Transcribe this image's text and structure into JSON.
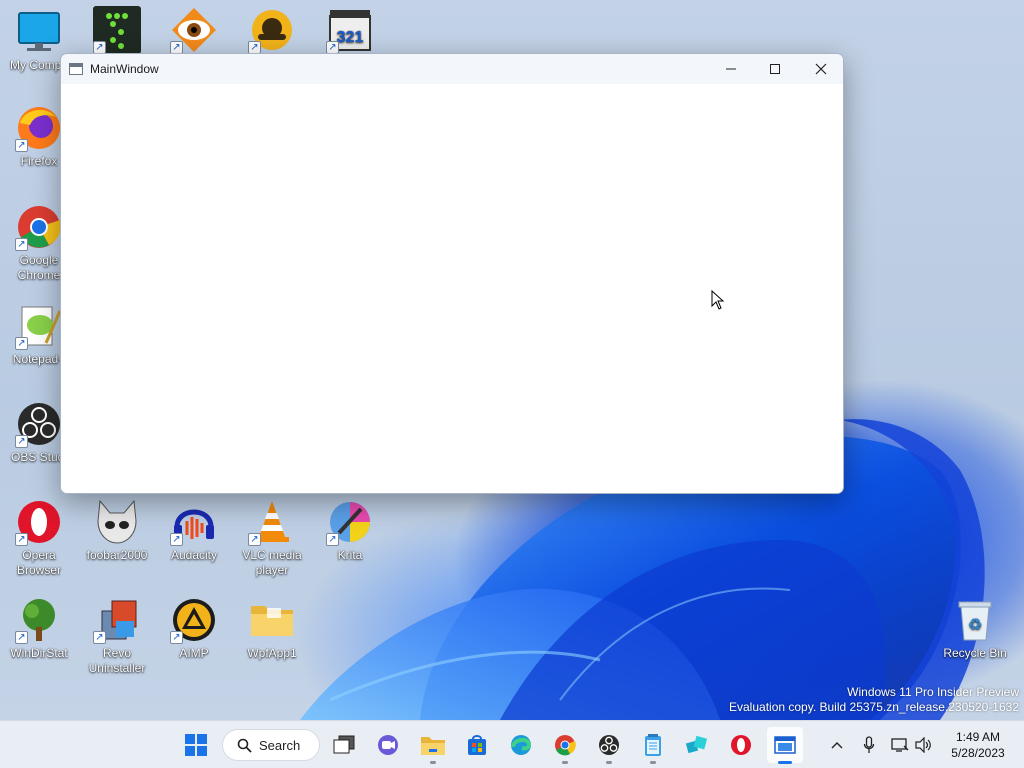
{
  "window": {
    "title": "MainWindow"
  },
  "desktop": {
    "icons": [
      {
        "label": "My Compu",
        "icon": "monitor-icon"
      },
      {
        "label": "",
        "icon": "green-dots-app-icon"
      },
      {
        "label": "",
        "icon": "eye-app-icon"
      },
      {
        "label": "",
        "icon": "mascot-app-icon"
      },
      {
        "label": "",
        "icon": "media-player-classic-icon"
      },
      {
        "label": "Firefox",
        "icon": "firefox-icon"
      },
      {
        "label": "Google Chrome",
        "icon": "chrome-icon"
      },
      {
        "label": "Notepad+",
        "icon": "notepad-plus-plus-icon"
      },
      {
        "label": "OBS Studi",
        "icon": "obs-icon"
      },
      {
        "label": "Opera Browser",
        "icon": "opera-icon"
      },
      {
        "label": "foobar2000",
        "icon": "foobar2000-icon"
      },
      {
        "label": "Audacity",
        "icon": "audacity-icon"
      },
      {
        "label": "VLC media player",
        "icon": "vlc-icon"
      },
      {
        "label": "Krita",
        "icon": "krita-icon"
      },
      {
        "label": "WinDirStat",
        "icon": "windirstat-icon"
      },
      {
        "label": "Revo Uninstaller",
        "icon": "revo-uninstaller-icon"
      },
      {
        "label": "AIMP",
        "icon": "aimp-icon"
      },
      {
        "label": "WpfApp1",
        "icon": "folder-icon"
      },
      {
        "label": "Recycle Bin",
        "icon": "recycle-bin-icon"
      }
    ]
  },
  "watermark": {
    "line1": "Windows 11 Pro Insider Preview",
    "line2": "Evaluation copy. Build 25375.zn_release.230520-1632"
  },
  "taskbar": {
    "search_label": "Search",
    "time": "1:49 AM",
    "date": "5/28/2023"
  },
  "colors": {
    "accent": "#1a73e8",
    "taskbar_bg": "#e9eef5",
    "window_bg": "#ffffff"
  }
}
